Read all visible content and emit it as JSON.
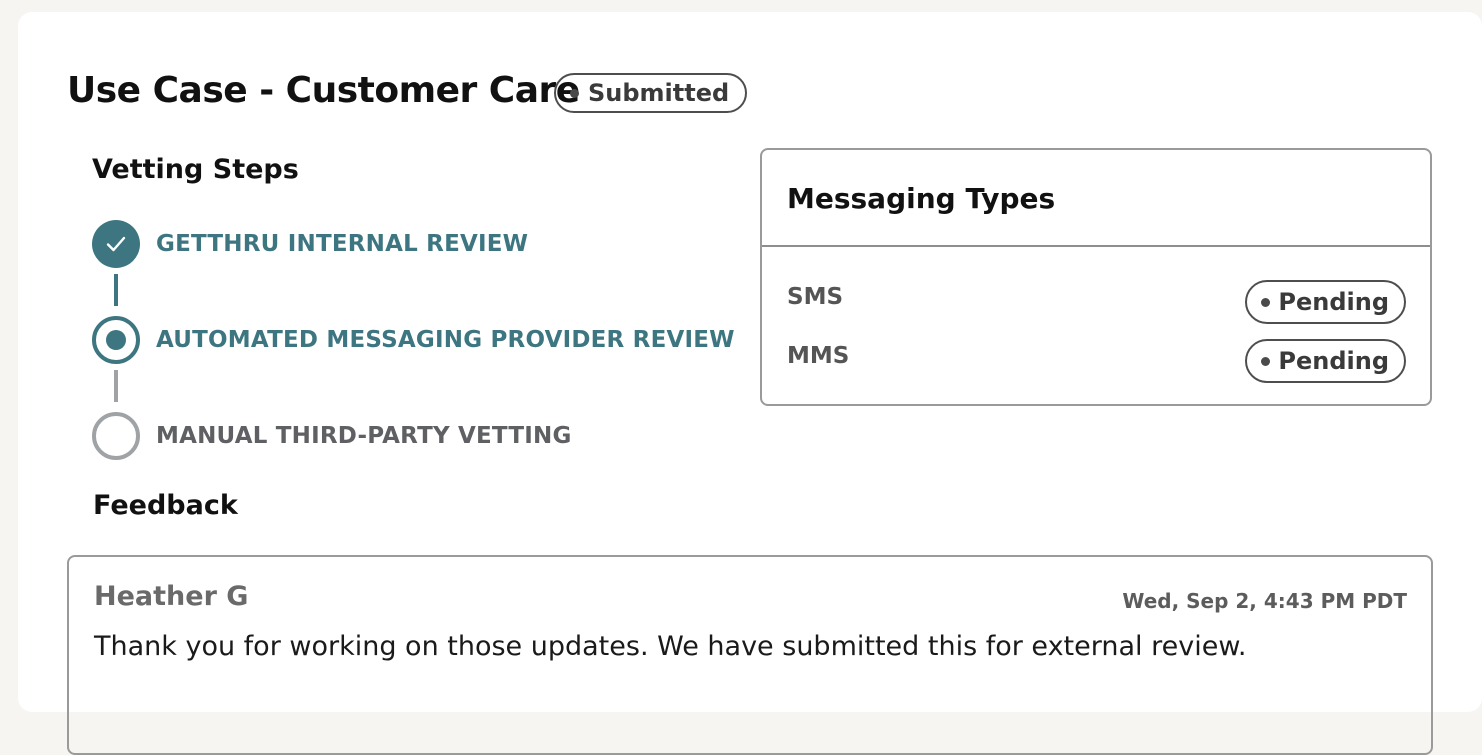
{
  "header": {
    "title": "Use Case - Customer Care",
    "status": "Submitted"
  },
  "vetting": {
    "heading": "Vetting Steps",
    "steps": [
      {
        "label": "GETTHRU INTERNAL REVIEW",
        "state": "complete"
      },
      {
        "label": "AUTOMATED MESSAGING PROVIDER REVIEW",
        "state": "in-progress"
      },
      {
        "label": "MANUAL THIRD-PARTY VETTING",
        "state": "not-started"
      }
    ]
  },
  "messaging": {
    "heading": "Messaging Types",
    "types": [
      {
        "name": "SMS",
        "status": "Pending"
      },
      {
        "name": "MMS",
        "status": "Pending"
      }
    ]
  },
  "feedback": {
    "heading": "Feedback",
    "entries": [
      {
        "author": "Heather G",
        "timestamp": "Wed, Sep 2, 4:43 PM PDT",
        "message": "Thank you for working on those updates. We have submitted this for external review."
      }
    ]
  },
  "colors": {
    "accent": "#3d7681",
    "inactive": "#a0a3a6",
    "pill_border": "#4e4e4e"
  },
  "icons": {
    "step_complete": "checkmark-icon",
    "step_active": "radio-dot-icon",
    "step_todo": "empty-circle-icon",
    "status_dot": "dot-icon"
  }
}
